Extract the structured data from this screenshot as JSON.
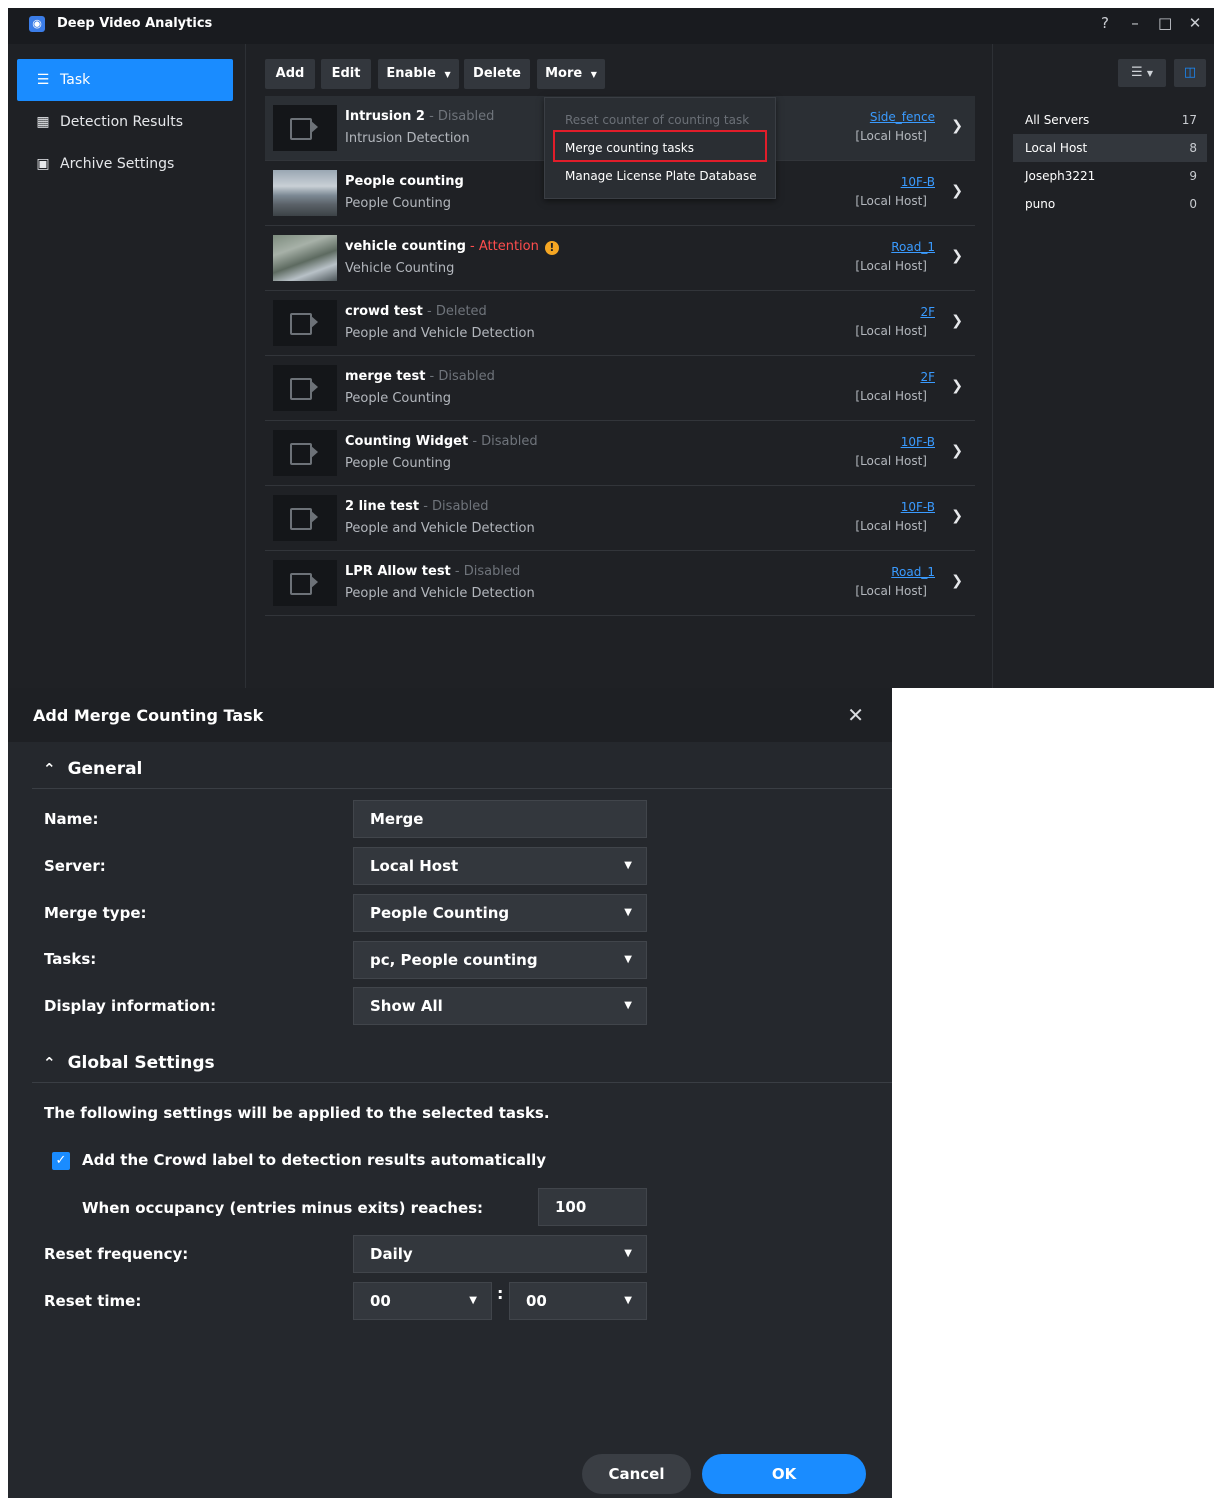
{
  "app": {
    "title": "Deep Video Analytics",
    "window_controls": [
      "?",
      "–",
      "□",
      "✕"
    ]
  },
  "sidebar": {
    "items": [
      {
        "label": "Task",
        "icon": "list-icon",
        "active": true
      },
      {
        "label": "Detection Results",
        "icon": "document-icon",
        "active": false
      },
      {
        "label": "Archive Settings",
        "icon": "archive-icon",
        "active": false
      }
    ]
  },
  "toolbar": {
    "add": "Add",
    "edit": "Edit",
    "enable": "Enable",
    "delete": "Delete",
    "more": "More"
  },
  "more_menu": {
    "items": [
      {
        "label": "Reset counter of counting task",
        "disabled": true
      },
      {
        "label": "Merge counting tasks",
        "highlighted": true
      },
      {
        "label": "Manage License Plate Database",
        "disabled": false
      }
    ]
  },
  "tasks": [
    {
      "name": "Intrusion 2",
      "status": "Disabled",
      "type": "Intrusion Detection",
      "location": "Side_fence",
      "host": "[Local Host]",
      "thumb": "camera"
    },
    {
      "name": "People counting",
      "status": "",
      "type": "People Counting",
      "location": "10F-B",
      "host": "[Local Host]",
      "thumb": "office-image"
    },
    {
      "name": "vehicle counting",
      "status": "Attention",
      "type": "Vehicle Counting",
      "location": "Road_1",
      "host": "[Local Host]",
      "thumb": "road-image"
    },
    {
      "name": "crowd test",
      "status": "Deleted",
      "type": "People and Vehicle Detection",
      "location": "2F",
      "host": "[Local Host]",
      "thumb": "camera"
    },
    {
      "name": "merge test",
      "status": "Disabled",
      "type": "People Counting",
      "location": "2F",
      "host": "[Local Host]",
      "thumb": "camera"
    },
    {
      "name": "Counting Widget",
      "status": "Disabled",
      "type": "People Counting",
      "location": "10F-B",
      "host": "[Local Host]",
      "thumb": "camera"
    },
    {
      "name": "2 line test",
      "status": "Disabled",
      "type": "People and Vehicle Detection",
      "location": "10F-B",
      "host": "[Local Host]",
      "thumb": "camera"
    },
    {
      "name": "LPR Allow test",
      "status": "Disabled",
      "type": "People and Vehicle Detection",
      "location": "Road_1",
      "host": "[Local Host]",
      "thumb": "camera"
    }
  ],
  "servers": [
    {
      "name": "All Servers",
      "count": "17"
    },
    {
      "name": "Local Host",
      "count": "8",
      "active": true
    },
    {
      "name": "Joseph3221",
      "count": "9"
    },
    {
      "name": "puno",
      "count": "0"
    }
  ],
  "dialog": {
    "title": "Add Merge Counting Task",
    "general_section": "General",
    "fields": {
      "name_label": "Name:",
      "name_value": "Merge",
      "server_label": "Server:",
      "server_value": "Local Host",
      "merge_type_label": "Merge type:",
      "merge_type_value": "People Counting",
      "tasks_label": "Tasks:",
      "tasks_value": "pc, People counting",
      "display_label": "Display information:",
      "display_value": "Show All"
    },
    "global_section": "Global Settings",
    "global_desc": "The following settings will be applied to the selected tasks.",
    "crowd_label_checkbox": "Add the Crowd label to detection results automatically",
    "crowd_label_checked": true,
    "occupancy_label": "When occupancy (entries minus exits) reaches:",
    "occupancy_value": "100",
    "reset_freq_label": "Reset frequency:",
    "reset_freq_value": "Daily",
    "reset_time_label": "Reset time:",
    "reset_hour": "00",
    "reset_minute": "00",
    "time_sep": ":",
    "cancel": "Cancel",
    "ok": "OK"
  },
  "colors": {
    "accent": "#1a8cff",
    "link": "#3a9bff",
    "attention": "#ff4d4d",
    "highlight_border": "#e11d2a"
  }
}
